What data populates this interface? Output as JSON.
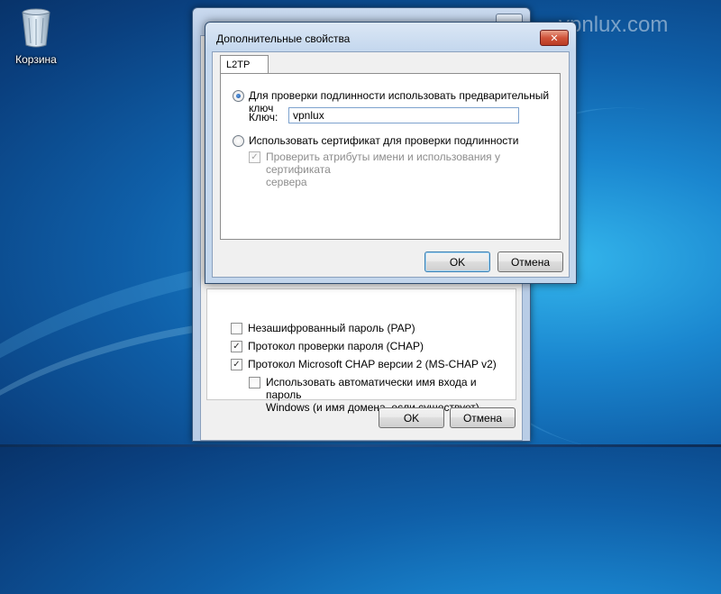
{
  "desktop": {
    "recycle_bin_label": "Корзина",
    "watermark": "vpnlux.com"
  },
  "back_dialog": {
    "options": [
      {
        "label": "Незашифрованный пароль (PAP)",
        "checked": false
      },
      {
        "label": "Протокол проверки пароля (CHAP)",
        "checked": true
      },
      {
        "label": "Протокол Microsoft CHAP версии 2 (MS-CHAP v2)",
        "checked": true
      }
    ],
    "sub_option": {
      "line1": "Использовать автоматически имя входа и пароль",
      "line2": "Windows (и имя домена, если существует)",
      "checked": false
    },
    "ok_label": "OK",
    "cancel_label": "Отмена"
  },
  "dialog": {
    "title": "Дополнительные свойства",
    "close_glyph": "✕",
    "tab_label": "L2TP",
    "radio_psk_label": "Для проверки подлинности использовать предварительный ключ",
    "key_label": "Ключ:",
    "key_value": "vpnlux",
    "radio_cert_label": "Использовать сертификат для проверки подлинности",
    "verify_line1": "Проверить атрибуты имени и использования у сертификата",
    "verify_line2": "сервера",
    "ok_label": "OK",
    "cancel_label": "Отмена"
  }
}
